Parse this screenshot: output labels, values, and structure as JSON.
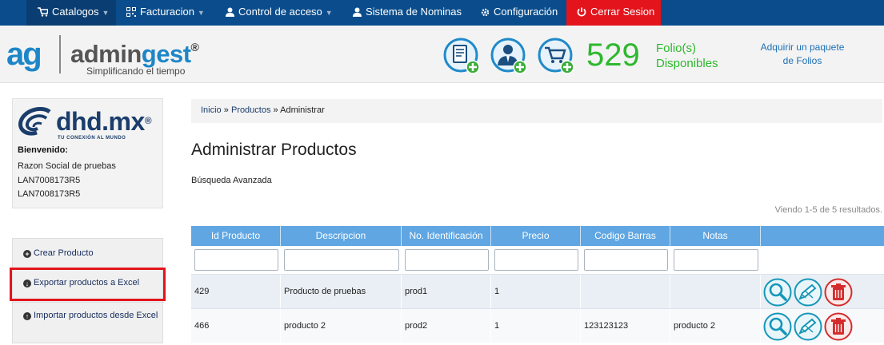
{
  "nav": {
    "items": [
      {
        "label": "Catalogos",
        "icon": "cart-icon"
      },
      {
        "label": "Facturacion",
        "icon": "qrcode-icon"
      },
      {
        "label": "Control de acceso",
        "icon": "user-icon"
      },
      {
        "label": "Sistema de Nominas",
        "icon": "user-icon"
      },
      {
        "label": "Configuración",
        "icon": "gear-icon"
      },
      {
        "label": "Cerrar Sesion",
        "icon": "power-icon"
      }
    ]
  },
  "header": {
    "brand_main": "admin",
    "brand_accent": "gest",
    "brand_reg": "®",
    "tagline": "Simplificando el tiempo",
    "logo_text": "ag",
    "folio_count": "529",
    "folio_label_line1": "Folio(s)",
    "folio_label_line2": "Disponibles",
    "buy_line1": "Adquirir un paquete",
    "buy_line2": "de Folios"
  },
  "user": {
    "company_logo": "dhd.mx",
    "company_reg": "®",
    "company_tagline": "TU CONEXIÓN AL MUNDO",
    "welcome": "Bienvenido:",
    "lines": [
      "Razon Social de pruebas",
      "LAN7008173R5",
      "LAN7008173R5"
    ]
  },
  "sidebar_menu": {
    "items": [
      {
        "label": "Crear Producto",
        "icon": "plus-circle-icon"
      },
      {
        "label": "Exportar productos a Excel",
        "icon": "download-circle-icon"
      },
      {
        "label": "Importar productos desde Excel",
        "icon": "upload-circle-icon"
      }
    ]
  },
  "breadcrumb": {
    "items": [
      "Inicio",
      "Productos",
      "Administrar"
    ],
    "separator": "»"
  },
  "page": {
    "title": "Administrar Productos",
    "advanced_search": "Búsqueda Avanzada",
    "summary": "Viendo 1-5 de 5 resultados."
  },
  "table": {
    "columns": [
      "Id Producto",
      "Descripcion",
      "No. Identificación",
      "Precio",
      "Codigo Barras",
      "Notas"
    ],
    "rows": [
      {
        "id": "429",
        "descripcion": "Producto de pruebas",
        "identificacion": "prod1",
        "precio": "1",
        "codigo_barras": "",
        "notas": ""
      },
      {
        "id": "466",
        "descripcion": "producto 2",
        "identificacion": "prod2",
        "precio": "1",
        "codigo_barras": "123123123",
        "notas": "producto 2"
      }
    ],
    "row_actions": [
      "view-icon",
      "edit-icon",
      "delete-icon"
    ]
  },
  "colors": {
    "nav_bg": "#0b4d8c",
    "logout_bg": "#e3141c",
    "brand_blue": "#1d86c7",
    "folio_green": "#2eb82e",
    "grid_header": "#5fa6e2"
  }
}
